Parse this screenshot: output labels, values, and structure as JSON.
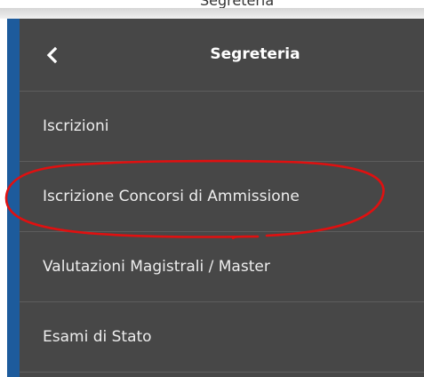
{
  "page_header": {
    "clipped_label": "Segreteria"
  },
  "menu": {
    "title": "Segreteria",
    "back_icon": "chevron-left-icon",
    "items": [
      {
        "label": "Iscrizioni"
      },
      {
        "label": "Iscrizione Concorsi di Ammissione"
      },
      {
        "label": "Valutazioni Magistrali / Master"
      },
      {
        "label": "Esami di Stato"
      }
    ]
  },
  "colors": {
    "menu_background": "#474747",
    "accent_bar": "#1d5b9c",
    "divider": "#5d5d5d",
    "text": "#ededed",
    "annotation_circle": "#e01010"
  },
  "annotation": {
    "shape": "freehand-circle",
    "highlights": "Iscrizione Concorsi di Ammissione"
  }
}
